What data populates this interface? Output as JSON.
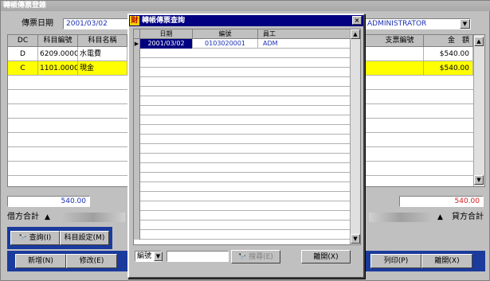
{
  "window": {
    "title": "轉帳傳票登錄"
  },
  "header": {
    "date_label": "傳票日期",
    "date_value": "2001/03/02",
    "user_value": "ADMINISTRATOR"
  },
  "main_grid": {
    "columns": {
      "dc": "DC",
      "code": "科目編號",
      "name": "科目名稱",
      "check": "支票編號",
      "amount": "金　額"
    },
    "rows": [
      {
        "dc": "D",
        "code": "6209.00000",
        "name": "水電費",
        "amount": "$540.00"
      },
      {
        "dc": "C",
        "code": "1101.00000",
        "name": "現金",
        "amount": "$540.00"
      }
    ]
  },
  "totals": {
    "debit_value": "540.00",
    "credit_value": "540.00",
    "debit_label": "借方合計",
    "credit_label": "貸方合計"
  },
  "panel_buttons": {
    "query": "查詢(I)",
    "settings": "科目設定(M)"
  },
  "bottom_buttons": {
    "add": "新增(N)",
    "edit": "修改(E)",
    "print": "列印(P)",
    "exit": "離開(X)"
  },
  "dialog": {
    "icon_text": "財",
    "title": "轉帳傳票查詢",
    "close_glyph": "×",
    "columns": {
      "date": "日期",
      "number": "編號",
      "staff": "員工"
    },
    "rows": [
      {
        "date": "2001/03/02",
        "number": "0103020001",
        "staff": "ADM"
      }
    ],
    "search_field_select": "編號",
    "search_input": "",
    "search_button": "搜尋(E)",
    "exit_button": "離開(X)"
  },
  "colors": {
    "selection": "#ffff00",
    "title": "#000080",
    "panel": "#1a3a9c",
    "red": "#d02020",
    "blue": "#1a2fb0"
  }
}
